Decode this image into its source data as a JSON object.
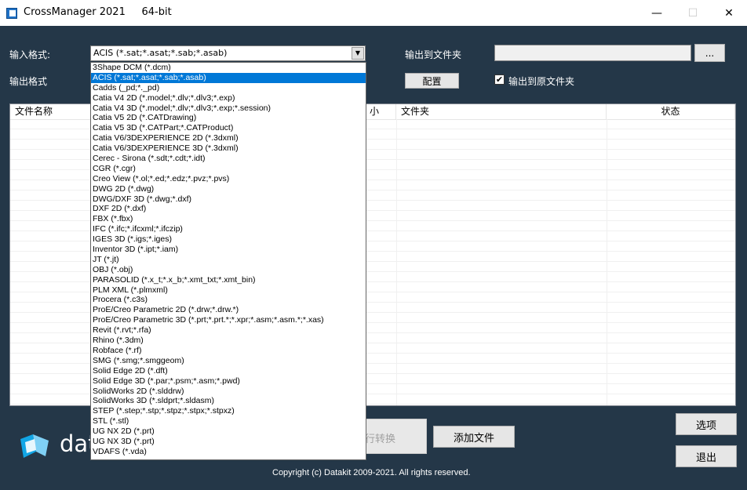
{
  "window": {
    "title": "CrossManager 2021     64-bit",
    "minimize": "—",
    "maximize": "☐",
    "close": "✕"
  },
  "form": {
    "input_format_label": "输入格式:",
    "input_format_value": "ACIS (*.sat;*.asat;*.sab;*.asab)",
    "output_format_label": "输出格式",
    "output_folder_label": "输出到文件夹",
    "output_folder_value": "",
    "browse_label": "...",
    "config_label": "配置",
    "output_to_source_label": "输出到原文件夹",
    "output_to_source_checked": true
  },
  "table": {
    "columns": [
      "文件名称",
      "小",
      "文件夹",
      "状态"
    ]
  },
  "buttons": {
    "convert": "行转换",
    "add_files": "添加文件",
    "options": "选项",
    "exit": "退出"
  },
  "brand": {
    "logo_text": "dat",
    "copyright": "Copyright (c) Datakit 2009-2021. All rights reserved."
  },
  "dropdown": {
    "selected_index": 1,
    "options": [
      "3Shape DCM (*.dcm)",
      "ACIS (*.sat;*.asat;*.sab;*.asab)",
      "Cadds (_pd;*._pd)",
      "Catia V4 2D (*.model;*.dlv;*.dlv3;*.exp)",
      "Catia V4 3D (*.model;*.dlv;*.dlv3;*.exp;*.session)",
      "Catia V5 2D (*.CATDrawing)",
      "Catia V5 3D (*.CATPart;*.CATProduct)",
      "Catia V6/3DEXPERIENCE 2D (*.3dxml)",
      "Catia V6/3DEXPERIENCE 3D (*.3dxml)",
      "Cerec - Sirona (*.sdt;*.cdt;*.idt)",
      "CGR (*.cgr)",
      "Creo View (*.ol;*.ed;*.edz;*.pvz;*.pvs)",
      "DWG 2D (*.dwg)",
      "DWG/DXF 3D (*.dwg;*.dxf)",
      "DXF 2D (*.dxf)",
      "FBX (*.fbx)",
      "IFC (*.ifc;*.ifcxml;*.ifczip)",
      "IGES 3D (*.igs;*.iges)",
      "Inventor 3D (*.ipt;*.iam)",
      "JT (*.jt)",
      "OBJ (*.obj)",
      "PARASOLID (*.x_t;*.x_b;*.xmt_txt;*.xmt_bin)",
      "PLM XML (*.plmxml)",
      "Procera (*.c3s)",
      "ProE/Creo Parametric 2D (*.drw;*.drw.*)",
      "ProE/Creo Parametric 3D (*.prt;*.prt.*;*.xpr;*.asm;*.asm.*;*.xas)",
      "Revit (*.rvt;*.rfa)",
      "Rhino (*.3dm)",
      "Robface (*.rf)",
      "SMG (*.smg;*.smggeom)",
      "Solid Edge 2D (*.dft)",
      "Solid Edge 3D (*.par;*.psm;*.asm;*.pwd)",
      "SolidWorks 2D (*.slddrw)",
      "SolidWorks 3D (*.sldprt;*.sldasm)",
      "STEP (*.step;*.stp;*.stpz;*.stpx;*.stpxz)",
      "STL (*.stl)",
      "UG NX 2D (*.prt)",
      "UG NX 3D (*.prt)",
      "VDAFS (*.vda)"
    ]
  },
  "colors": {
    "background": "#243748",
    "selection": "#0078d7"
  }
}
